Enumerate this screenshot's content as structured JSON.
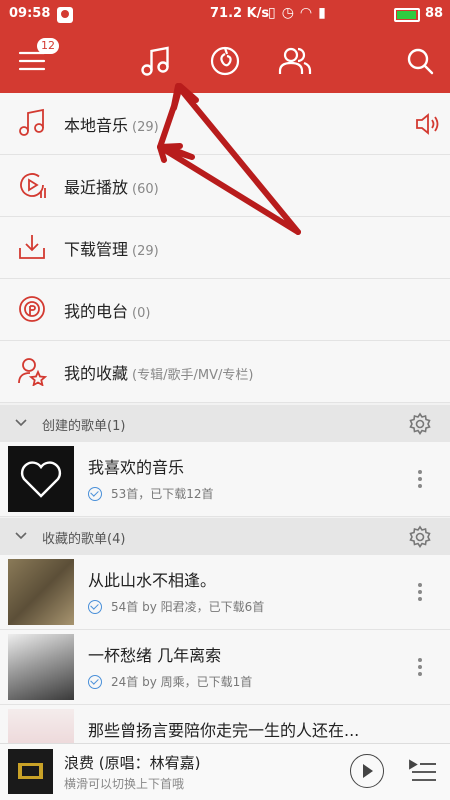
{
  "status": {
    "time": "09:58",
    "net_speed": "71.2 K/s",
    "battery": "88",
    "battery_fill_fraction": 0.88
  },
  "nav": {
    "badge": "12",
    "tabs": [
      "menu-icon",
      "music-note-icon",
      "radio-icon",
      "friends-icon",
      "search-icon"
    ]
  },
  "menu": [
    {
      "label": "本地音乐",
      "count": "(29)",
      "icon": "music-note-icon"
    },
    {
      "label": "最近播放",
      "count": "(60)",
      "icon": "recent-play-icon"
    },
    {
      "label": "下载管理",
      "count": "(29)",
      "icon": "download-icon"
    },
    {
      "label": "我的电台",
      "count": "(0)",
      "icon": "podcast-icon"
    },
    {
      "label": "我的收藏",
      "count": "(专辑/歌手/MV/专栏)",
      "icon": "favorite-user-icon"
    }
  ],
  "sections": {
    "created": {
      "title": "创建的歌单(1)"
    },
    "collected": {
      "title": "收藏的歌单(4)"
    }
  },
  "playlists": {
    "created": [
      {
        "title": "我喜欢的音乐",
        "meta": "53首，已下载12首"
      }
    ],
    "collected": [
      {
        "title": "从此山水不相逢。",
        "meta": "54首 by 阳君凌，已下载6首"
      },
      {
        "title": "一杯愁绪 几年离索",
        "meta": "24首 by 周乘，已下载1首"
      },
      {
        "title": "那些曾扬言要陪你走完一生的人还在..."
      }
    ]
  },
  "player": {
    "title": "浪费 (原唱：林宥嘉)",
    "subtitle": "横滑可以切换上下首哦"
  },
  "colors": {
    "brand_red": "#d33a31",
    "annotation_arrow": "#b81c1c",
    "check_blue": "#4a90d9"
  }
}
